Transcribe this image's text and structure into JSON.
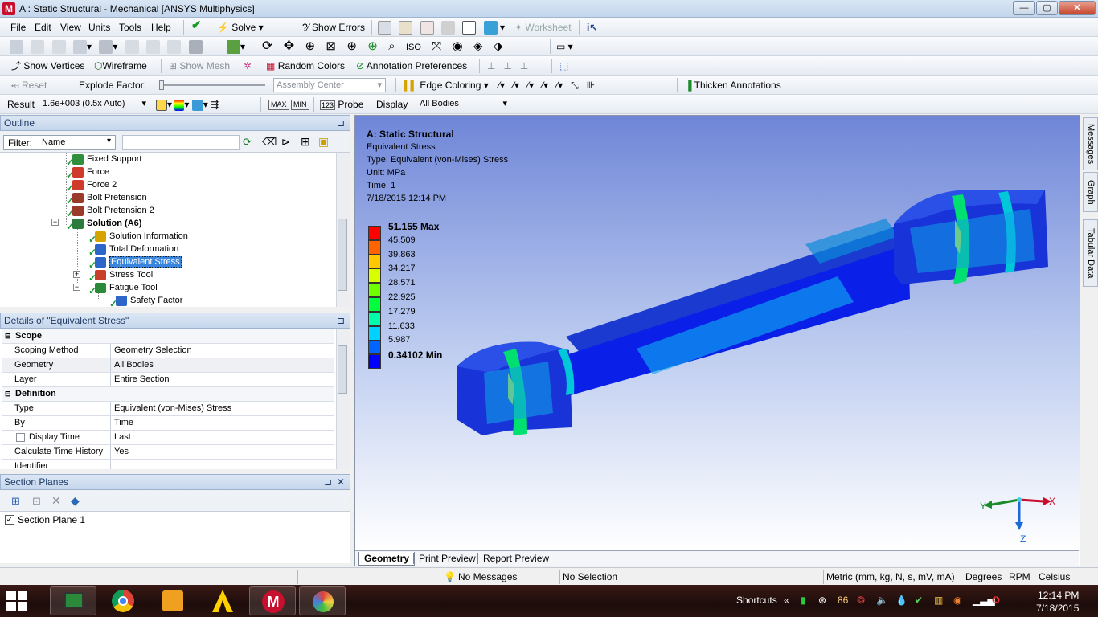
{
  "window": {
    "title": "A : Static Structural - Mechanical [ANSYS Multiphysics]",
    "app_letter": "M",
    "min": "—",
    "max": "▢",
    "close": "✕"
  },
  "menubar": {
    "items": [
      "File",
      "Edit",
      "View",
      "Units",
      "Tools",
      "Help"
    ],
    "solve": "Solve",
    "show_errors": "Show Errors",
    "worksheet": "Worksheet"
  },
  "toolbar3": {
    "show_vertices": "Show Vertices",
    "wireframe": "Wireframe",
    "show_mesh": "Show Mesh",
    "random_colors": "Random Colors",
    "annotation_preferences": "Annotation Preferences"
  },
  "toolbar4": {
    "reset": "Reset",
    "explode_factor": "Explode Factor:",
    "assembly_center": "Assembly Center",
    "edge_coloring": "Edge Coloring",
    "thicken_annotations": "Thicken Annotations"
  },
  "toolbar5": {
    "result_label": "Result",
    "result_value": "1.6e+003 (0.5x Auto)",
    "probe": "Probe",
    "display_label": "Display",
    "display_value": "All Bodies"
  },
  "outline": {
    "title": "Outline",
    "filter_label": "Filter:",
    "filter_value": "Name",
    "items": [
      {
        "label": "Fixed Support",
        "color": "#2f8f3a"
      },
      {
        "label": "Force",
        "color": "#cf3a2a"
      },
      {
        "label": "Force 2",
        "color": "#cf3a2a"
      },
      {
        "label": "Bolt Pretension",
        "color": "#9b3a2a"
      },
      {
        "label": "Bolt Pretension 2",
        "color": "#9b3a2a"
      },
      {
        "label": "Solution (A6)",
        "color": "#2c7a3c"
      },
      {
        "label": "Solution Information",
        "color": "#d6a400"
      },
      {
        "label": "Total Deformation",
        "color": "#2c66c8"
      },
      {
        "label": "Equivalent Stress",
        "color": "#2c66c8"
      },
      {
        "label": "Stress Tool",
        "color": "#c8402c"
      },
      {
        "label": "Fatigue Tool",
        "color": "#2a8a3a"
      },
      {
        "label": "Safety Factor",
        "color": "#2c66c8"
      }
    ]
  },
  "details": {
    "title": "Details of \"Equivalent Stress\"",
    "rows": [
      {
        "key": "Scope",
        "value": ""
      },
      {
        "key": "Scoping Method",
        "value": "Geometry Selection"
      },
      {
        "key": "Geometry",
        "value": "All Bodies"
      },
      {
        "key": "Layer",
        "value": "Entire Section"
      },
      {
        "key": "Definition",
        "value": ""
      },
      {
        "key": "Type",
        "value": "Equivalent (von-Mises) Stress"
      },
      {
        "key": "By",
        "value": "Time"
      },
      {
        "key": "Display Time",
        "value": "Last"
      },
      {
        "key": "Calculate Time History",
        "value": "Yes"
      },
      {
        "key": "Identifier",
        "value": ""
      }
    ]
  },
  "section_planes": {
    "title": "Section Planes",
    "items": [
      "Section Plane 1"
    ]
  },
  "viewport": {
    "header": [
      "A: Static Structural",
      "Equivalent Stress",
      "Type: Equivalent (von-Mises) Stress",
      "Unit: MPa",
      "Time: 1",
      "7/18/2015 12:14 PM"
    ],
    "legend": [
      {
        "label": "51.155 Max",
        "color": "#ff0000"
      },
      {
        "label": "45.509",
        "color": "#ff6400"
      },
      {
        "label": "39.863",
        "color": "#ffc800"
      },
      {
        "label": "34.217",
        "color": "#d7ff00"
      },
      {
        "label": "28.571",
        "color": "#6eff00"
      },
      {
        "label": "22.925",
        "color": "#00ff3c"
      },
      {
        "label": "17.279",
        "color": "#00ffaa"
      },
      {
        "label": "11.633",
        "color": "#00d2ff"
      },
      {
        "label": "5.987",
        "color": "#0064ff"
      },
      {
        "label": "0.34102 Min",
        "color": "#0000ff"
      }
    ],
    "axes": {
      "x": "X",
      "y": "Y",
      "z": "Z"
    },
    "tabs": [
      "Geometry",
      "Print Preview",
      "Report Preview"
    ],
    "side_tabs": [
      "Messages",
      "Graph",
      "Tabular Data"
    ]
  },
  "status": {
    "messages": "No Messages",
    "selection": "No Selection",
    "units": "Metric (mm, kg, N, s, mV, mA)",
    "angle": "Degrees",
    "speed": "RPM",
    "temp": "Celsius"
  },
  "taskbar": {
    "shortcuts": "Shortcuts",
    "temp": "86",
    "time": "12:14 PM",
    "date": "7/18/2015"
  }
}
